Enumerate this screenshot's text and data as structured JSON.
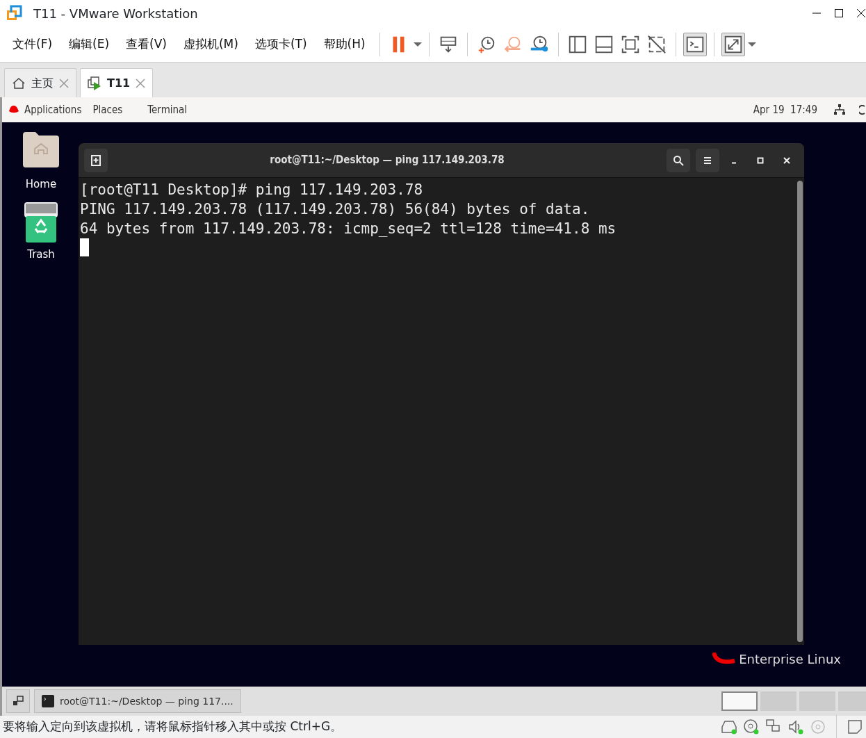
{
  "window": {
    "title": "T11 - VMware Workstation"
  },
  "menu": [
    "文件(F)",
    "编辑(E)",
    "查看(V)",
    "虚拟机(M)",
    "选项卡(T)",
    "帮助(H)"
  ],
  "toolbar": [
    {
      "kind": "pause",
      "on": false
    },
    {
      "kind": "sep"
    },
    {
      "kind": "send-keys",
      "on": false
    },
    {
      "kind": "sep"
    },
    {
      "kind": "snapshot",
      "on": false
    },
    {
      "kind": "revert",
      "on": false
    },
    {
      "kind": "manage",
      "on": false
    },
    {
      "kind": "sep"
    },
    {
      "kind": "library",
      "on": false
    },
    {
      "kind": "thumbs",
      "on": false
    },
    {
      "kind": "fullview",
      "on": false
    },
    {
      "kind": "unity",
      "on": false
    },
    {
      "kind": "sep"
    },
    {
      "kind": "console",
      "on": true
    },
    {
      "kind": "sep"
    },
    {
      "kind": "stretch",
      "on": true
    }
  ],
  "tabs": [
    {
      "label": "主页",
      "kind": "home",
      "selected": false
    },
    {
      "label": "T11",
      "kind": "vm",
      "selected": true
    }
  ],
  "gnome_bar": {
    "items": [
      "Applications",
      "Places",
      "Terminal"
    ],
    "clock": "Apr 19  17:49"
  },
  "desktop_icons": [
    {
      "label": "Home",
      "kind": "folder"
    },
    {
      "label": "Trash",
      "kind": "trash"
    }
  ],
  "terminal": {
    "title": "root@T11:~/Desktop — ping 117.149.203.78",
    "lines": [
      "[root@T11 Desktop]# ping 117.149.203.78",
      "PING 117.149.203.78 (117.149.203.78) 56(84) bytes of data.",
      "64 bytes from 117.149.203.78: icmp_seq=2 ttl=128 time=41.8 ms"
    ]
  },
  "brand": "Enterprise Linux",
  "taskbar": {
    "item": "root@T11:~/Desktop — ping 117...."
  },
  "workspaces": [
    {
      "selected": true
    },
    {
      "selected": false
    },
    {
      "selected": false
    },
    {
      "selected": false
    }
  ],
  "status_bar": {
    "message": "要将输入定向到该虚拟机，请将鼠标指针移入其中或按 Ctrl+G。"
  }
}
